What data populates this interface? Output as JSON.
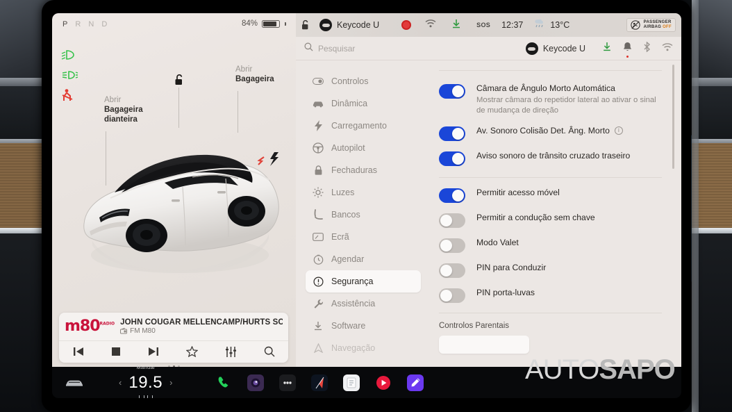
{
  "theme": {
    "accent_blue": "#1a46d8",
    "toggle_off": "#c6c1bd",
    "pane_bg": "#ece7e4",
    "left_pane_bg": "#efe9e6",
    "taskbar_bg": "#08090b",
    "alert_orange": "#d97a14",
    "brand_red": "#c9133b"
  },
  "drive_view": {
    "gear_indicator": "P R N D",
    "gear_active": "P",
    "battery_percent": "84%",
    "telltales": [
      "headlight-low-beam-green",
      "front-fog-light-green",
      "seatbelt-unbuckled-red"
    ],
    "callouts": [
      {
        "line1": "Abrir",
        "line2": "Bagageira",
        "line3": "dianteira"
      },
      {
        "line1": "Abrir",
        "line2": "Bagageira",
        "line3": ""
      }
    ],
    "lock_state": "unlocked",
    "vehicle": "white-tesla-model-y"
  },
  "media": {
    "station_logo": "m80",
    "station_logo_sup": "RADIO",
    "title": "JOHN COUGAR MELLENCAMP/HURTS SO GOOD",
    "source": "FM M80",
    "controls": [
      "previous-icon",
      "stop-icon",
      "next-icon",
      "favorite-star-icon",
      "equalizer-icon",
      "search-icon"
    ],
    "page_dots": 3,
    "page_dot_active": 1
  },
  "status_bar": {
    "lock_icon": "unlocked-padlock-icon",
    "profile_name": "Keycode U",
    "icons": [
      "record-icon",
      "wifi-icon",
      "download-icon",
      "sos-icon"
    ],
    "time": "12:37",
    "weather_icon": "light-rain-icon",
    "temperature": "13°C",
    "airbag_line1": "PASSENGER",
    "airbag_line2": "AIRBAG",
    "airbag_state": "OFF"
  },
  "settings_header": {
    "search_placeholder": "Pesquisar",
    "account_name": "Keycode U",
    "icons": [
      "download-icon",
      "notification-bell-icon",
      "bluetooth-icon",
      "wifi-icon"
    ],
    "bell_has_badge": true
  },
  "sidebar": {
    "items": [
      {
        "label": "Controlos",
        "icon": "toggle-switch-icon",
        "active": false,
        "dim": false
      },
      {
        "label": "Dinâmica",
        "icon": "car-dynamics-icon",
        "active": false,
        "dim": false
      },
      {
        "label": "Carregamento",
        "icon": "bolt-icon",
        "active": false,
        "dim": false
      },
      {
        "label": "Autopilot",
        "icon": "steering-wheel-icon",
        "active": false,
        "dim": false
      },
      {
        "label": "Fechaduras",
        "icon": "lock-icon",
        "active": false,
        "dim": false
      },
      {
        "label": "Luzes",
        "icon": "sun-light-icon",
        "active": false,
        "dim": false
      },
      {
        "label": "Bancos",
        "icon": "seat-icon",
        "active": false,
        "dim": false
      },
      {
        "label": "Ecrã",
        "icon": "display-icon",
        "active": false,
        "dim": false
      },
      {
        "label": "Agendar",
        "icon": "clock-schedule-icon",
        "active": false,
        "dim": false
      },
      {
        "label": "Segurança",
        "icon": "alert-circle-icon",
        "active": true,
        "dim": false
      },
      {
        "label": "Assistência",
        "icon": "wrench-icon",
        "active": false,
        "dim": false
      },
      {
        "label": "Software",
        "icon": "download-icon",
        "active": false,
        "dim": false
      },
      {
        "label": "Navegação",
        "icon": "navigation-icon",
        "active": false,
        "dim": true
      }
    ]
  },
  "settings_list": {
    "items": [
      {
        "label": "Câmara de Ângulo Morto Automática",
        "desc": "Mostrar câmara do repetidor lateral ao ativar o sinal de mudança de direção",
        "on": true,
        "info": false
      },
      {
        "label": "Av. Sonoro Colisão Det. Âng. Morto",
        "desc": "",
        "on": true,
        "info": true
      },
      {
        "label": "Aviso sonoro de trânsito cruzado traseiro",
        "desc": "",
        "on": true,
        "info": false
      },
      {
        "label": "Permitir acesso móvel",
        "desc": "",
        "on": true,
        "info": false,
        "group_start": true
      },
      {
        "label": "Permitir a condução sem chave",
        "desc": "",
        "on": false,
        "info": false
      },
      {
        "label": "Modo Valet",
        "desc": "",
        "on": false,
        "info": false
      },
      {
        "label": "PIN para Conduzir",
        "desc": "",
        "on": false,
        "info": false
      },
      {
        "label": "PIN porta-luvas",
        "desc": "",
        "on": false,
        "info": false
      }
    ],
    "section_title": "Controlos Parentais"
  },
  "taskbar": {
    "car_icon": "car-front-icon",
    "climate_mode": "Manual",
    "temperature": "19.5",
    "left_chevron": "‹",
    "right_chevron": "›",
    "apps": [
      {
        "name": "phone-app-icon",
        "glyph": "📞"
      },
      {
        "name": "camera-app-icon",
        "glyph": "◉"
      },
      {
        "name": "apps-grid-icon",
        "glyph": "•••"
      },
      {
        "name": "maps-app-icon",
        "glyph": "➤"
      },
      {
        "name": "notes-app-icon",
        "glyph": "▤"
      },
      {
        "name": "youtube-music-app-icon",
        "glyph": "▶"
      },
      {
        "name": "karaoke-app-icon",
        "glyph": "🎤"
      }
    ]
  },
  "watermark": {
    "part1": "AUTO",
    "part2": "SAPO"
  }
}
